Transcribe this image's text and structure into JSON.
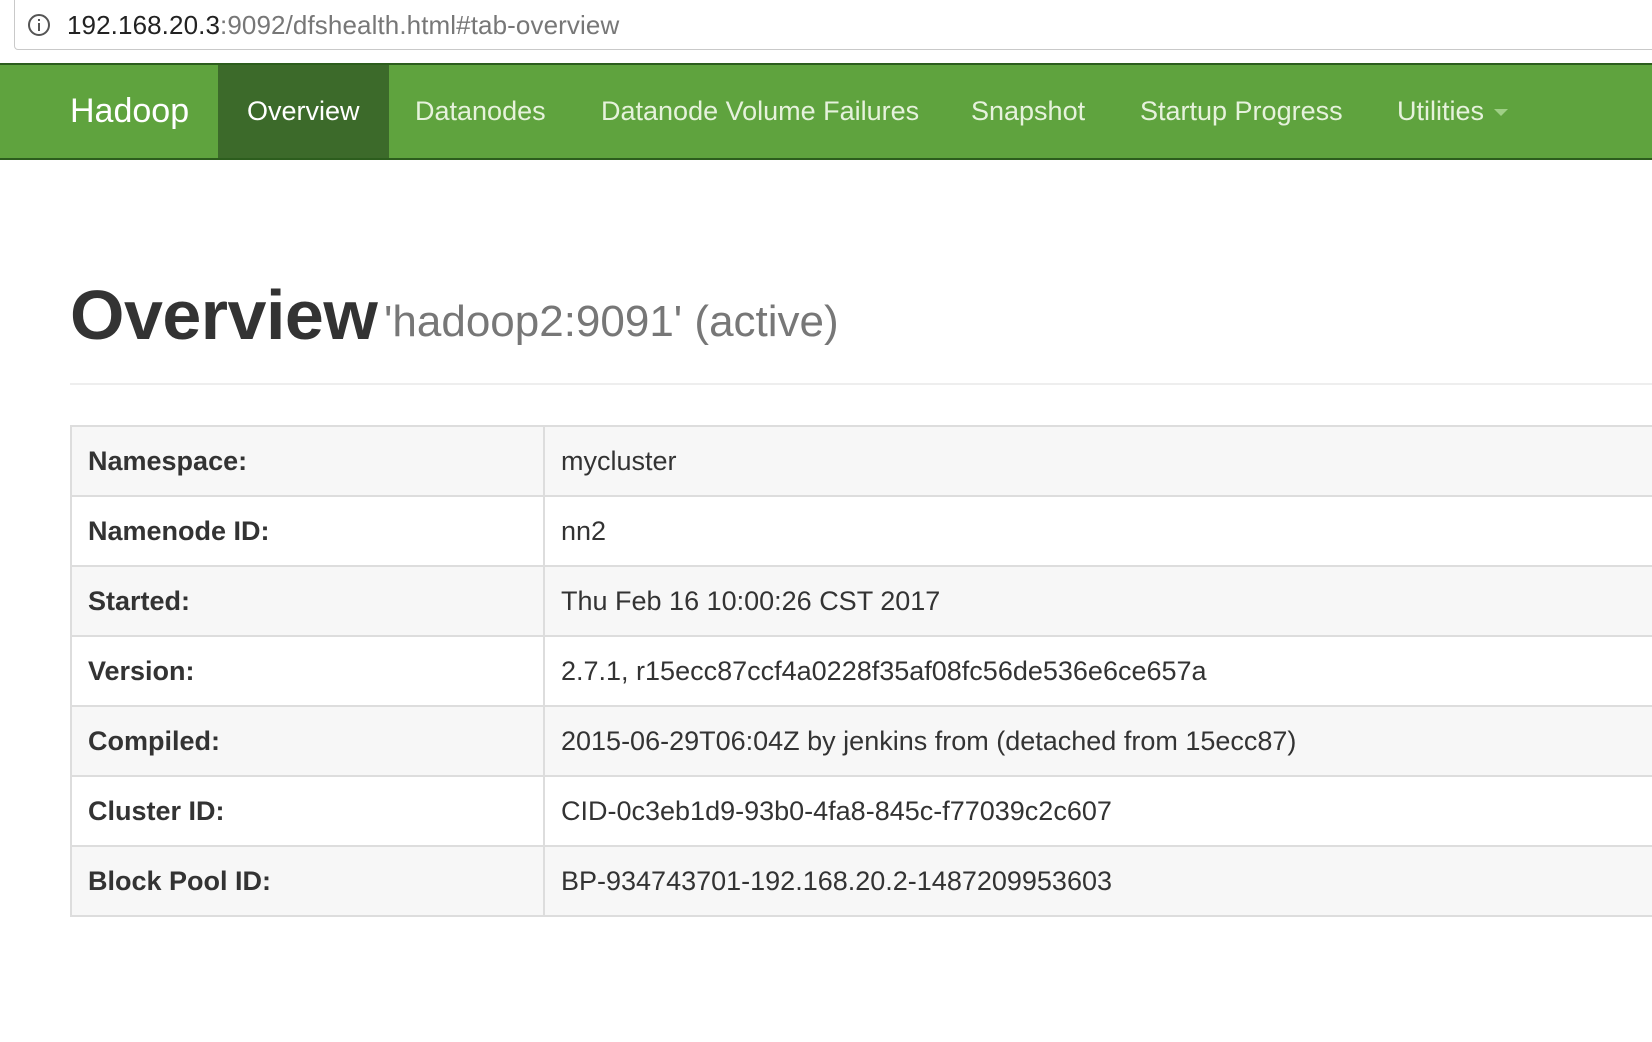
{
  "browser": {
    "url_host": "192.168.20.3",
    "url_path": ":9092/dfshealth.html#tab-overview",
    "info_icon": "info-circle-icon"
  },
  "navbar": {
    "brand": "Hadoop",
    "items": [
      {
        "label": "Overview",
        "active": true
      },
      {
        "label": "Datanodes",
        "active": false
      },
      {
        "label": "Datanode Volume Failures",
        "active": false
      },
      {
        "label": "Snapshot",
        "active": false
      },
      {
        "label": "Startup Progress",
        "active": false
      },
      {
        "label": "Utilities",
        "active": false,
        "dropdown": true
      }
    ],
    "colors": {
      "background": "#5fa33e",
      "active_background": "#3c6a2a"
    }
  },
  "header": {
    "title": "Overview",
    "subtitle": "'hadoop2:9091' (active)"
  },
  "overview": {
    "rows": [
      {
        "key": "Namespace:",
        "value": "mycluster"
      },
      {
        "key": "Namenode ID:",
        "value": "nn2"
      },
      {
        "key": "Started:",
        "value": "Thu Feb 16 10:00:26 CST 2017"
      },
      {
        "key": "Version:",
        "value": "2.7.1, r15ecc87ccf4a0228f35af08fc56de536e6ce657a"
      },
      {
        "key": "Compiled:",
        "value": "2015-06-29T06:04Z by jenkins from (detached from 15ecc87)"
      },
      {
        "key": "Cluster ID:",
        "value": "CID-0c3eb1d9-93b0-4fa8-845c-f77039c2c607"
      },
      {
        "key": "Block Pool ID:",
        "value": "BP-934743701-192.168.20.2-1487209953603"
      }
    ]
  }
}
